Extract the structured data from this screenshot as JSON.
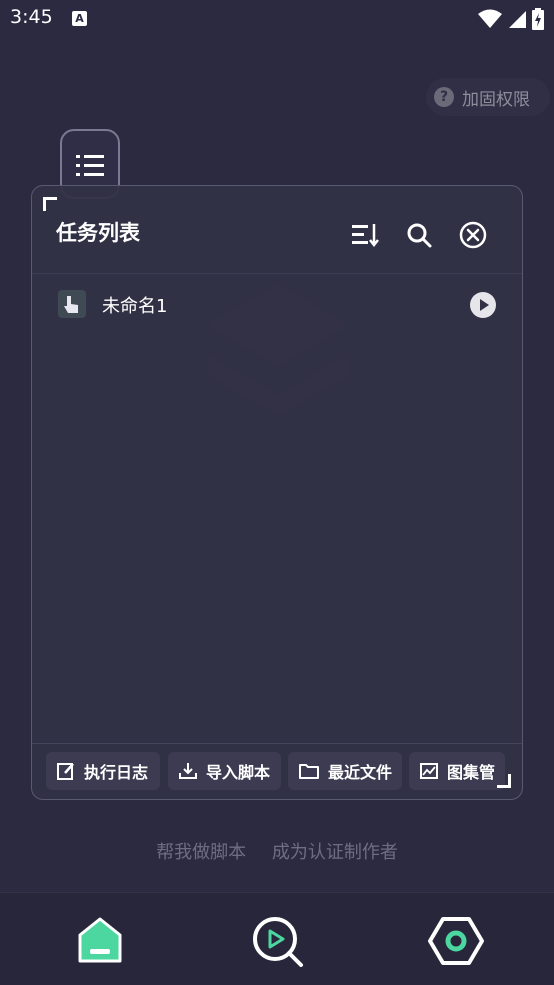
{
  "status_bar": {
    "time": "3:45",
    "notification_icon": "A"
  },
  "reinforce": {
    "icon": "?",
    "label": "加固权限"
  },
  "panel": {
    "title": "任务列表",
    "tasks": [
      {
        "name": "未命名1"
      }
    ],
    "footer": [
      {
        "label": "执行日志",
        "icon": "edit-icon"
      },
      {
        "label": "导入脚本",
        "icon": "download-icon"
      },
      {
        "label": "最近文件",
        "icon": "folder-icon"
      },
      {
        "label": "图集管",
        "icon": "gallery-icon"
      }
    ]
  },
  "helper_links": {
    "help": "帮我做脚本",
    "author": "成为认证制作者"
  },
  "colors": {
    "background": "#2b2a40",
    "accent_green": "#4cd6a0",
    "panel": "#323146"
  }
}
